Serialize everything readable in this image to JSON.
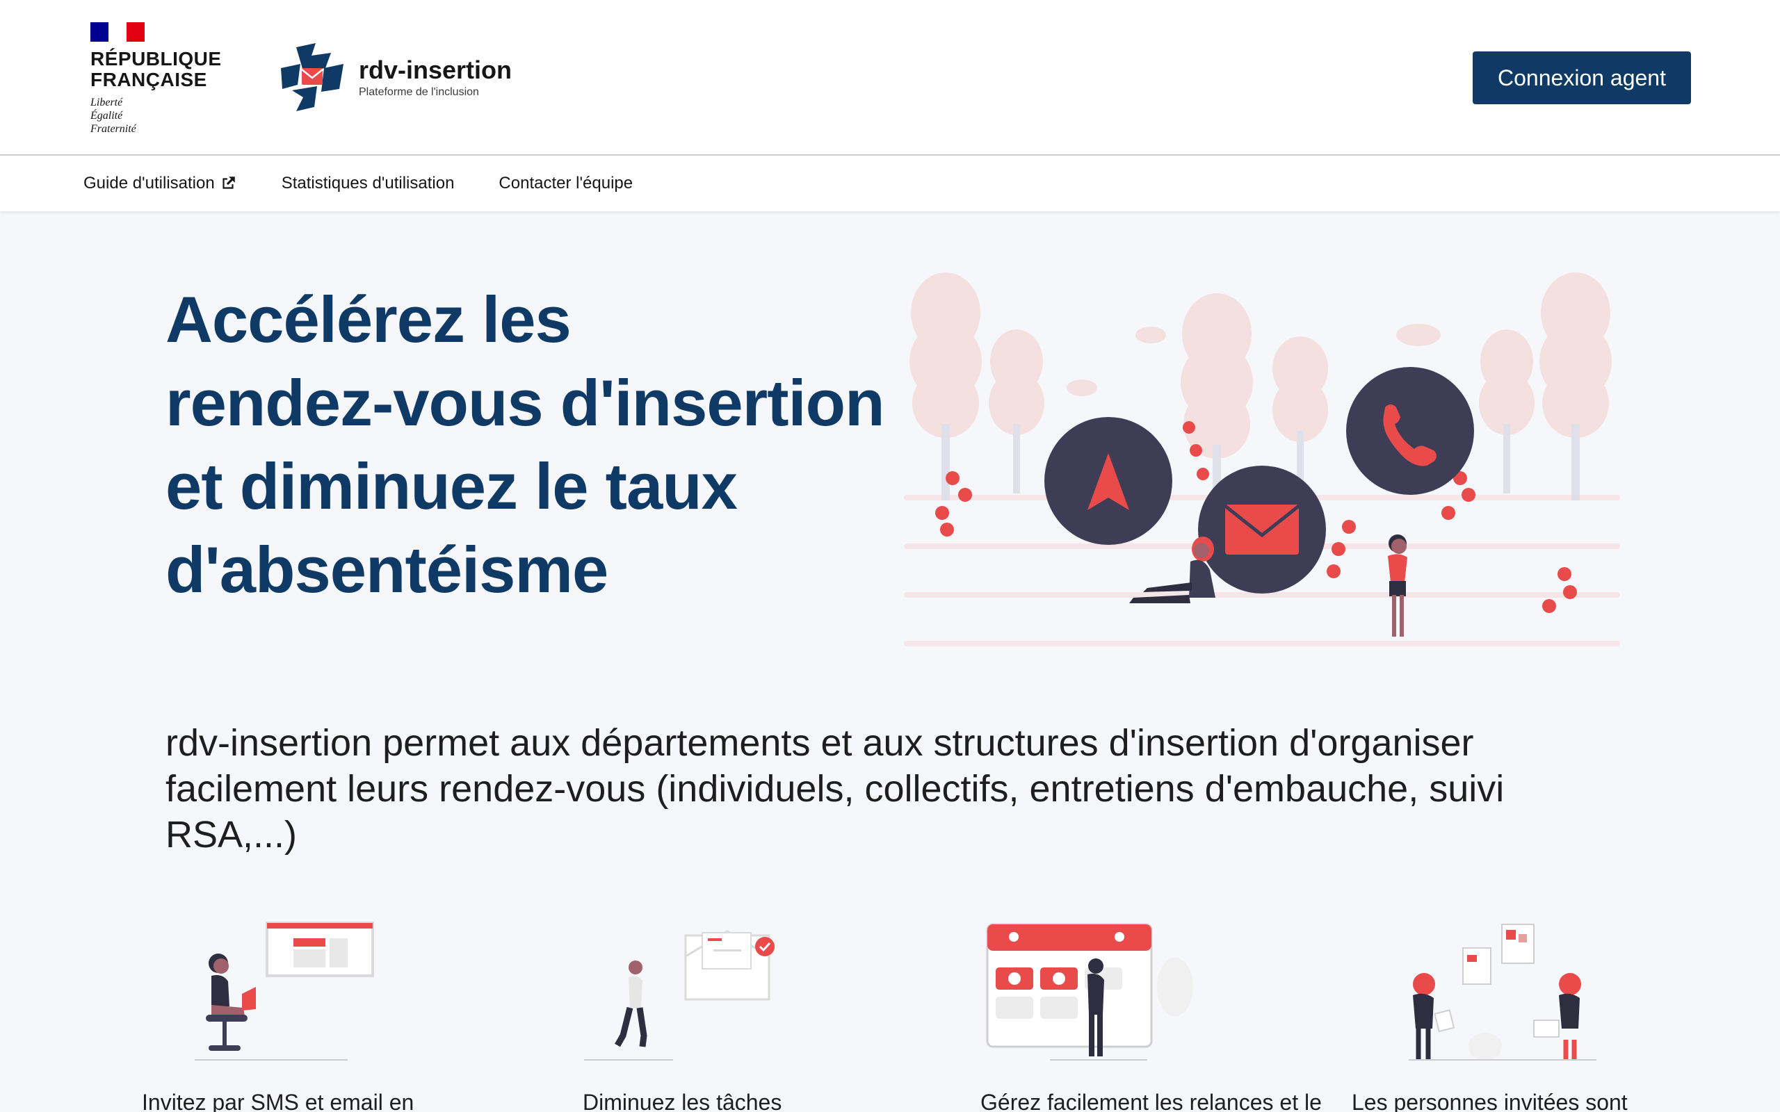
{
  "header": {
    "rf_title_line1": "RÉPUBLIQUE",
    "rf_title_line2": "FRANÇAISE",
    "rf_motto_1": "Liberté",
    "rf_motto_2": "Égalité",
    "rf_motto_3": "Fraternité",
    "brand_name": "rdv-insertion",
    "brand_tagline": "Plateforme de l'inclusion",
    "login_label": "Connexion agent"
  },
  "nav": {
    "items": [
      {
        "label": "Guide d'utilisation",
        "icon": "external-link-icon"
      },
      {
        "label": "Statistiques d'utilisation"
      },
      {
        "label": "Contacter l'équipe"
      }
    ]
  },
  "hero": {
    "title_line1": "Accélérez les",
    "title_line2": "rendez-vous d'insertion",
    "title_line3": "et diminuez le taux",
    "title_line4": "d'absentéisme"
  },
  "intro": {
    "text": "rdv-insertion permet aux départements et aux structures d'insertion d'organiser facilement leurs rendez-vous (individuels, collectifs, entretiens d'embauche, suivi RSA,...)"
  },
  "features": [
    {
      "text": "Invitez par SMS et email en"
    },
    {
      "text": "Diminuez les tâches"
    },
    {
      "text": "Gérez facilement les relances et le"
    },
    {
      "text": "Les personnes invitées sont"
    }
  ],
  "colors": {
    "primary": "#0f3a66",
    "accent": "#e94b4b",
    "dark": "#3f3d56"
  }
}
